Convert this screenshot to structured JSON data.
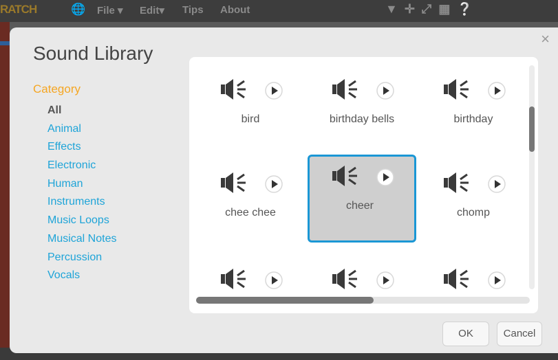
{
  "topbar": {
    "logo": "RATCH",
    "menus": [
      "File ▾",
      "Edit▾",
      "Tips",
      "About"
    ],
    "icons": [
      "stamp-icon",
      "cut-icon",
      "grow-icon",
      "shrink-icon",
      "help-icon"
    ]
  },
  "dialog": {
    "title": "Sound Library",
    "close": "×",
    "category_label": "Category",
    "categories": [
      {
        "label": "All",
        "selected": true
      },
      {
        "label": "Animal"
      },
      {
        "label": "Effects"
      },
      {
        "label": "Electronic"
      },
      {
        "label": "Human"
      },
      {
        "label": "Instruments"
      },
      {
        "label": "Music Loops"
      },
      {
        "label": "Musical Notes"
      },
      {
        "label": "Percussion"
      },
      {
        "label": "Vocals"
      }
    ],
    "sounds": [
      {
        "name": "bird"
      },
      {
        "name": "birthday bells"
      },
      {
        "name": "birthday"
      },
      {
        "name": "chee chee"
      },
      {
        "name": "cheer",
        "selected": true
      },
      {
        "name": "chomp"
      },
      {
        "name": ""
      },
      {
        "name": ""
      },
      {
        "name": ""
      }
    ],
    "ok_label": "OK",
    "cancel_label": "Cancel"
  },
  "colors": {
    "category_heading": "#f5a623",
    "category_link": "#1ea4d8",
    "selection_border": "#1a97d5",
    "icon": "#3a3a3a"
  }
}
